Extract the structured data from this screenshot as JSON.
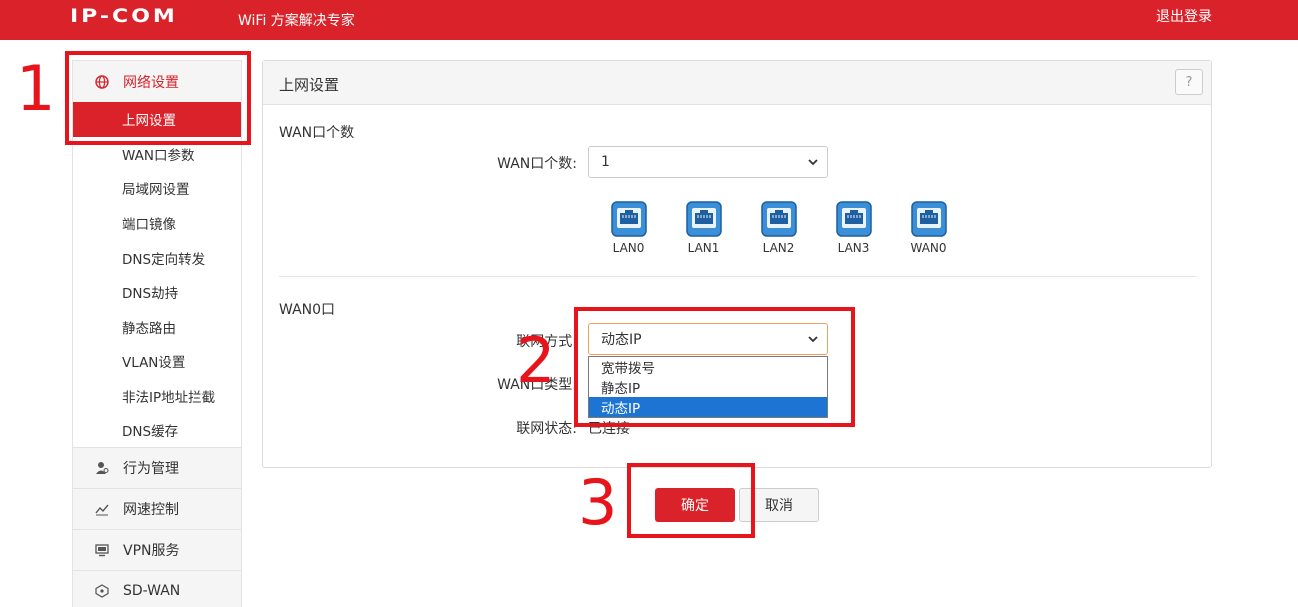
{
  "header": {
    "logo": "IP-COM",
    "slogan": "WiFi 方案解决专家",
    "logout": "退出登录"
  },
  "sidebar": {
    "groups": [
      {
        "label": "网络设置",
        "icon": "globe-icon"
      },
      {
        "label": "行为管理",
        "icon": "user-manage-icon"
      },
      {
        "label": "网速控制",
        "icon": "speed-chart-icon"
      },
      {
        "label": "VPN服务",
        "icon": "vpn-monitor-icon"
      },
      {
        "label": "SD-WAN",
        "icon": "sdwan-icon"
      }
    ],
    "sub_items": [
      "上网设置",
      "WAN口参数",
      "局域网设置",
      "端口镜像",
      "DNS定向转发",
      "DNS劫持",
      "静态路由",
      "VLAN设置",
      "非法IP地址拦截",
      "DNS缓存"
    ]
  },
  "panel": {
    "title": "上网设置",
    "help": "?",
    "wan_count_section": "WAN口个数",
    "wan_count_label": "WAN口个数:",
    "wan_count_value": "1",
    "ports": [
      "LAN0",
      "LAN1",
      "LAN2",
      "LAN3",
      "WAN0"
    ],
    "wan0_section": "WAN0口",
    "conn_mode_label": "联网方式:",
    "conn_mode_value": "动态IP",
    "conn_mode_options": [
      "宽带拨号",
      "静态IP",
      "动态IP"
    ],
    "wan_type_label": "WAN口类型:",
    "status_label": "联网状态:",
    "status_value": "已连接"
  },
  "buttons": {
    "ok": "确定",
    "cancel": "取消"
  },
  "annotations": [
    "1",
    "2",
    "3"
  ],
  "colors": {
    "brand": "#d9222a",
    "annotation": "#e8141b",
    "selection": "#1e74d3"
  }
}
